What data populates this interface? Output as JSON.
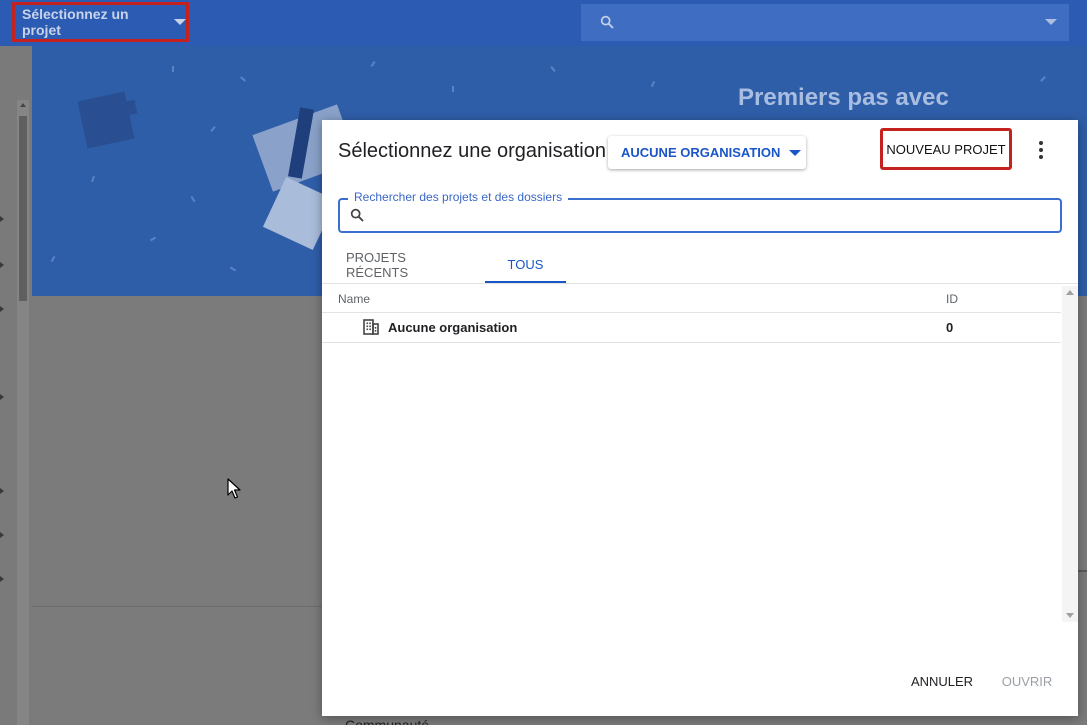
{
  "topbar": {
    "project_selector_label": "Sélectionnez un projet",
    "search_placeholder": ""
  },
  "background": {
    "hero_title": "Premiers pas avec",
    "bottom_text": "Communauté"
  },
  "dialog": {
    "title": "Sélectionnez une organisation",
    "org_dropdown_label": "AUCUNE ORGANISATION",
    "new_project_label": "NOUVEAU PROJET",
    "search": {
      "label": "Rechercher des projets et des dossiers",
      "value": ""
    },
    "tabs": [
      {
        "label": "PROJETS RÉCENTS",
        "active": false
      },
      {
        "label": "TOUS",
        "active": true
      }
    ],
    "table": {
      "columns": [
        "Name",
        "ID"
      ],
      "rows": [
        {
          "name": "Aucune organisation",
          "id": "0",
          "icon": "building-icon"
        }
      ]
    },
    "buttons": {
      "cancel": "ANNULER",
      "open": "OUVRIR"
    }
  },
  "colors": {
    "accent": "#1a56c7",
    "highlight_border": "#c5221f",
    "topbar": "#2b5bb3"
  }
}
